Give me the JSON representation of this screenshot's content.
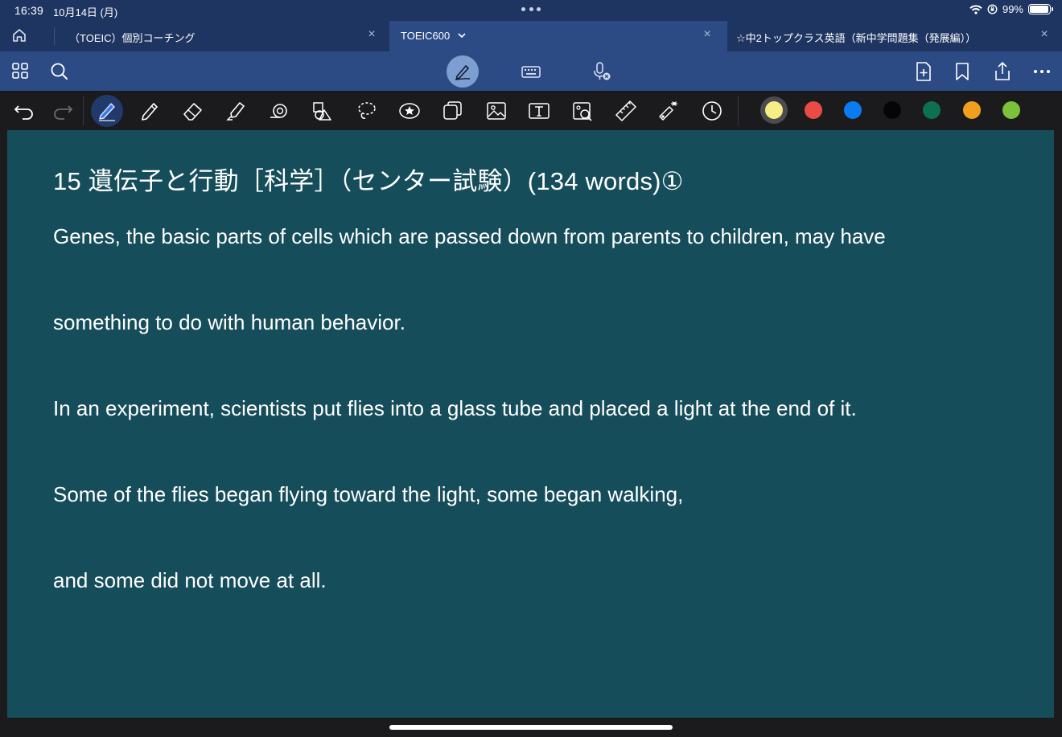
{
  "status": {
    "time": "16:39",
    "date": "10月14日 (月)",
    "battery": "99%"
  },
  "tabs": [
    {
      "label": "（TOEIC）個別コーチング",
      "active": false
    },
    {
      "label": "TOEIC600",
      "active": true
    },
    {
      "label": "☆中2トップクラス英語（新中学問題集（発展編））",
      "active": false
    }
  ],
  "toolbar": {
    "left_icons": [
      "grid-icon",
      "search-icon"
    ],
    "center_icons": [
      "pen-mode-icon",
      "keyboard-icon",
      "mic-off-icon"
    ],
    "right_icons": [
      "add-page-icon",
      "bookmark-icon",
      "share-icon",
      "more-icon"
    ]
  },
  "draw_tools": [
    "undo-icon",
    "redo-icon",
    "pen-tool-icon",
    "pencil-icon",
    "eraser-icon",
    "highlighter-icon",
    "tape-icon",
    "shapes-icon",
    "lasso-icon",
    "sticker-icon",
    "element-icon",
    "image-icon",
    "text-box-icon",
    "camera-scan-icon",
    "ruler-icon",
    "laser-pointer-icon",
    "timer-icon"
  ],
  "colors": [
    "#f6ee85",
    "#ea4b44",
    "#0a7cf0",
    "#050505",
    "#0d7051",
    "#f19f1f",
    "#7bc13a"
  ],
  "document": {
    "title": "15  遺伝子と行動［科学］（センター試験）(134 words)①",
    "lines": [
      "Genes, the basic parts of cells which are passed down from parents to children, may have",
      "something to do with human behavior.",
      "In an experiment, scientists put flies into a glass tube and placed a light at the end of it.",
      "Some of the flies began flying toward the light, some began walking,",
      "and some did not move at all."
    ]
  }
}
